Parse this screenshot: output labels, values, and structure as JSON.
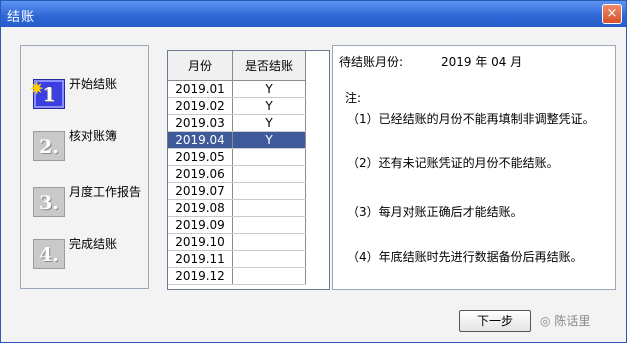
{
  "window": {
    "title": "结账",
    "close_glyph": "×"
  },
  "steps": [
    {
      "number": "1",
      "label": "开始结账",
      "active": true
    },
    {
      "number": "2.",
      "label": "核对账簿",
      "active": false
    },
    {
      "number": "3.",
      "label": "月度工作报告",
      "active": false
    },
    {
      "number": "4.",
      "label": "完成结账",
      "active": false
    }
  ],
  "month_table": {
    "headers": [
      "月份",
      "是否结账"
    ],
    "rows": [
      {
        "month": "2019.01",
        "closed": "Y"
      },
      {
        "month": "2019.02",
        "closed": "Y"
      },
      {
        "month": "2019.03",
        "closed": "Y"
      },
      {
        "month": "2019.04",
        "closed": "Y",
        "selected": true
      },
      {
        "month": "2019.05",
        "closed": ""
      },
      {
        "month": "2019.06",
        "closed": ""
      },
      {
        "month": "2019.07",
        "closed": ""
      },
      {
        "month": "2019.08",
        "closed": ""
      },
      {
        "month": "2019.09",
        "closed": ""
      },
      {
        "month": "2019.10",
        "closed": ""
      },
      {
        "month": "2019.11",
        "closed": ""
      },
      {
        "month": "2019.12",
        "closed": ""
      }
    ]
  },
  "notes": {
    "pending_label": "待结账月份:",
    "pending_value": "2019 年 04 月",
    "heading": "注:",
    "items": [
      "（1）已经结账的月份不能再填制非调整凭证。",
      "（2）还有未记账凭证的月份不能结账。",
      "（3）每月对账正确后才能结账。",
      "（4）年底结账时先进行数据备份后再结账。"
    ]
  },
  "buttons": {
    "next": "下一步",
    "cancel_watermark": "陈话里"
  }
}
